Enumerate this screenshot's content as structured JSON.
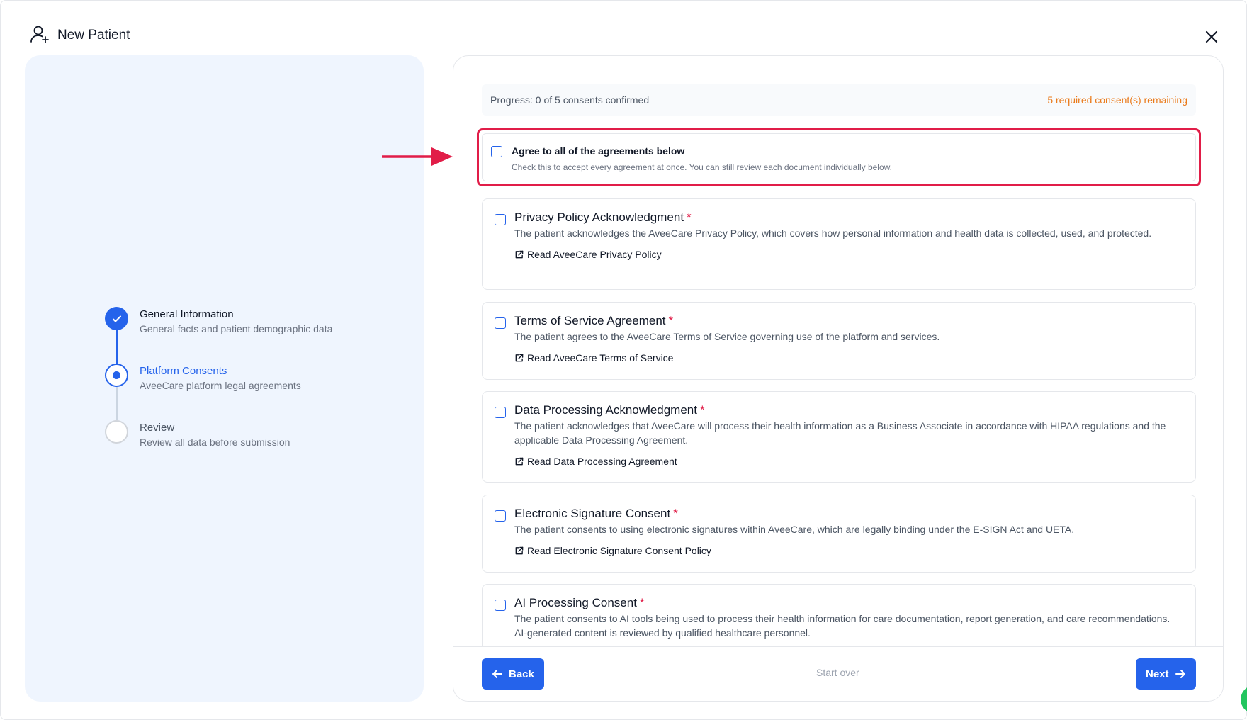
{
  "header": {
    "title": "New Patient",
    "icon": "user-plus-icon"
  },
  "steps": [
    {
      "title": "General Information",
      "description": "General facts and patient demographic data",
      "state": "completed"
    },
    {
      "title": "Platform Consents",
      "description": "AveeCare platform legal agreements",
      "state": "active"
    },
    {
      "title": "Review",
      "description": "Review all data before submission",
      "state": "pending"
    }
  ],
  "progress": {
    "text": "Progress: 0 of 5 consents confirmed",
    "remaining": "5 required consent(s) remaining"
  },
  "agree_all": {
    "title": "Agree to all of the agreements below",
    "description": "Check this to accept every agreement at once. You can still review each document individually below."
  },
  "consents": [
    {
      "title": "Privacy Policy Acknowledgment",
      "required": "*",
      "description": "The patient acknowledges the AveeCare Privacy Policy, which covers how personal information and health data is collected, used, and protected.",
      "link": "Read AveeCare Privacy Policy"
    },
    {
      "title": "Terms of Service Agreement",
      "required": "*",
      "description": "The patient agrees to the AveeCare Terms of Service governing use of the platform and services.",
      "link": "Read AveeCare Terms of Service"
    },
    {
      "title": "Data Processing Acknowledgment",
      "required": "*",
      "description": "The patient acknowledges that AveeCare will process their health information as a Business Associate in accordance with HIPAA regulations and the applicable Data Processing Agreement.",
      "link": "Read Data Processing Agreement"
    },
    {
      "title": "Electronic Signature Consent",
      "required": "*",
      "description": "The patient consents to using electronic signatures within AveeCare, which are legally binding under the E-SIGN Act and UETA.",
      "link": "Read Electronic Signature Consent Policy"
    },
    {
      "title": "AI Processing Consent",
      "required": "*",
      "description": "The patient consents to AI tools being used to process their health information for care documentation, report generation, and care recommendations. AI-generated content is reviewed by qualified healthcare personnel."
    }
  ],
  "footer": {
    "back_label": "Back",
    "start_over_label": "Start over",
    "next_label": "Next"
  },
  "colors": {
    "primary": "#2563eb",
    "warning": "#ea7a1a",
    "highlight": "#e11d48",
    "left_panel_bg": "#eff5fe"
  }
}
